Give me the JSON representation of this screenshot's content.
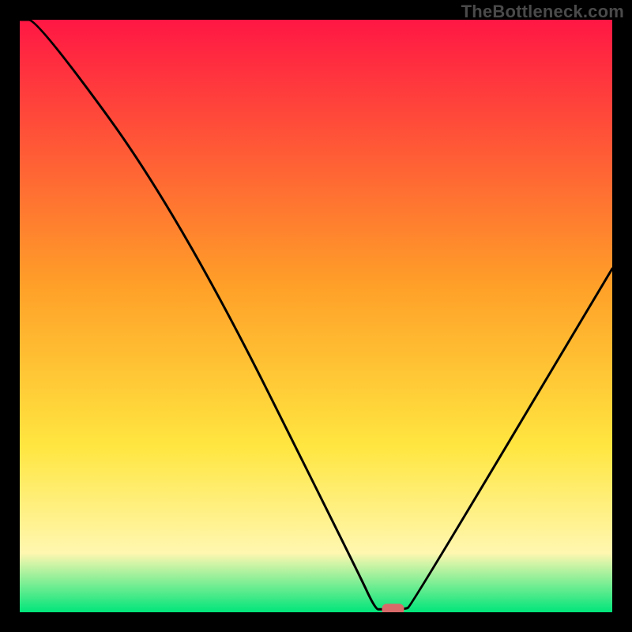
{
  "watermark": "TheBottleneck.com",
  "colors": {
    "top_red": "#ff1744",
    "mid_orange": "#ffa028",
    "yellow": "#ffe640",
    "pale_yellow": "#fff7b0",
    "green": "#00e57a",
    "curve": "#000000",
    "marker": "#d96a6a",
    "frame": "#000000"
  },
  "chart_data": {
    "type": "line",
    "title": "",
    "xlabel": "",
    "ylabel": "",
    "xlim": [
      0,
      100
    ],
    "ylim": [
      0,
      100
    ],
    "x": [
      0,
      3,
      27,
      57,
      60,
      61,
      65,
      66,
      100
    ],
    "values": [
      100,
      100,
      67,
      7,
      0.5,
      0.5,
      0.5,
      1,
      58
    ],
    "marker": {
      "x": 63,
      "y": 0.5
    },
    "notes": "V-shaped bottleneck curve over a vertical heat gradient; minimum near x≈63."
  }
}
